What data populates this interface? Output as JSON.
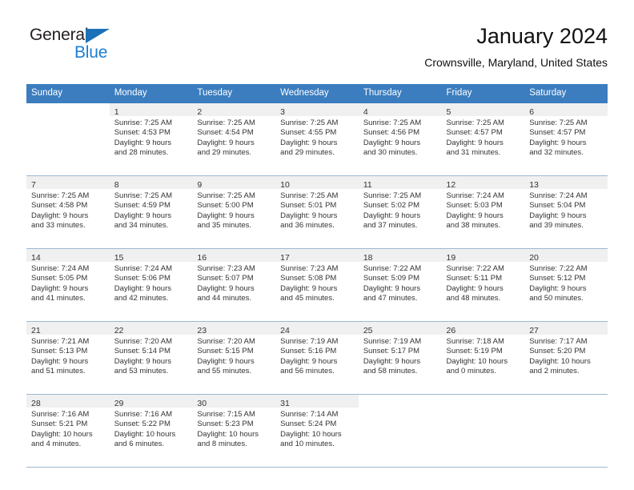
{
  "brand": {
    "name_part1": "General",
    "name_part2": "Blue",
    "accent_color": "#1c7fd1",
    "triangle_color": "#1c71b8"
  },
  "header": {
    "title": "January 2024",
    "subtitle": "Crownsville, Maryland, United States",
    "header_bg_color": "#3b7dbf",
    "header_text_color": "#ffffff"
  },
  "weekdays": [
    "Sunday",
    "Monday",
    "Tuesday",
    "Wednesday",
    "Thursday",
    "Friday",
    "Saturday"
  ],
  "weeks": [
    [
      {
        "day": "",
        "sunrise": "",
        "sunset": "",
        "daylight1": "",
        "daylight2": ""
      },
      {
        "day": "1",
        "sunrise": "Sunrise: 7:25 AM",
        "sunset": "Sunset: 4:53 PM",
        "daylight1": "Daylight: 9 hours",
        "daylight2": "and 28 minutes."
      },
      {
        "day": "2",
        "sunrise": "Sunrise: 7:25 AM",
        "sunset": "Sunset: 4:54 PM",
        "daylight1": "Daylight: 9 hours",
        "daylight2": "and 29 minutes."
      },
      {
        "day": "3",
        "sunrise": "Sunrise: 7:25 AM",
        "sunset": "Sunset: 4:55 PM",
        "daylight1": "Daylight: 9 hours",
        "daylight2": "and 29 minutes."
      },
      {
        "day": "4",
        "sunrise": "Sunrise: 7:25 AM",
        "sunset": "Sunset: 4:56 PM",
        "daylight1": "Daylight: 9 hours",
        "daylight2": "and 30 minutes."
      },
      {
        "day": "5",
        "sunrise": "Sunrise: 7:25 AM",
        "sunset": "Sunset: 4:57 PM",
        "daylight1": "Daylight: 9 hours",
        "daylight2": "and 31 minutes."
      },
      {
        "day": "6",
        "sunrise": "Sunrise: 7:25 AM",
        "sunset": "Sunset: 4:57 PM",
        "daylight1": "Daylight: 9 hours",
        "daylight2": "and 32 minutes."
      }
    ],
    [
      {
        "day": "7",
        "sunrise": "Sunrise: 7:25 AM",
        "sunset": "Sunset: 4:58 PM",
        "daylight1": "Daylight: 9 hours",
        "daylight2": "and 33 minutes."
      },
      {
        "day": "8",
        "sunrise": "Sunrise: 7:25 AM",
        "sunset": "Sunset: 4:59 PM",
        "daylight1": "Daylight: 9 hours",
        "daylight2": "and 34 minutes."
      },
      {
        "day": "9",
        "sunrise": "Sunrise: 7:25 AM",
        "sunset": "Sunset: 5:00 PM",
        "daylight1": "Daylight: 9 hours",
        "daylight2": "and 35 minutes."
      },
      {
        "day": "10",
        "sunrise": "Sunrise: 7:25 AM",
        "sunset": "Sunset: 5:01 PM",
        "daylight1": "Daylight: 9 hours",
        "daylight2": "and 36 minutes."
      },
      {
        "day": "11",
        "sunrise": "Sunrise: 7:25 AM",
        "sunset": "Sunset: 5:02 PM",
        "daylight1": "Daylight: 9 hours",
        "daylight2": "and 37 minutes."
      },
      {
        "day": "12",
        "sunrise": "Sunrise: 7:24 AM",
        "sunset": "Sunset: 5:03 PM",
        "daylight1": "Daylight: 9 hours",
        "daylight2": "and 38 minutes."
      },
      {
        "day": "13",
        "sunrise": "Sunrise: 7:24 AM",
        "sunset": "Sunset: 5:04 PM",
        "daylight1": "Daylight: 9 hours",
        "daylight2": "and 39 minutes."
      }
    ],
    [
      {
        "day": "14",
        "sunrise": "Sunrise: 7:24 AM",
        "sunset": "Sunset: 5:05 PM",
        "daylight1": "Daylight: 9 hours",
        "daylight2": "and 41 minutes."
      },
      {
        "day": "15",
        "sunrise": "Sunrise: 7:24 AM",
        "sunset": "Sunset: 5:06 PM",
        "daylight1": "Daylight: 9 hours",
        "daylight2": "and 42 minutes."
      },
      {
        "day": "16",
        "sunrise": "Sunrise: 7:23 AM",
        "sunset": "Sunset: 5:07 PM",
        "daylight1": "Daylight: 9 hours",
        "daylight2": "and 44 minutes."
      },
      {
        "day": "17",
        "sunrise": "Sunrise: 7:23 AM",
        "sunset": "Sunset: 5:08 PM",
        "daylight1": "Daylight: 9 hours",
        "daylight2": "and 45 minutes."
      },
      {
        "day": "18",
        "sunrise": "Sunrise: 7:22 AM",
        "sunset": "Sunset: 5:09 PM",
        "daylight1": "Daylight: 9 hours",
        "daylight2": "and 47 minutes."
      },
      {
        "day": "19",
        "sunrise": "Sunrise: 7:22 AM",
        "sunset": "Sunset: 5:11 PM",
        "daylight1": "Daylight: 9 hours",
        "daylight2": "and 48 minutes."
      },
      {
        "day": "20",
        "sunrise": "Sunrise: 7:22 AM",
        "sunset": "Sunset: 5:12 PM",
        "daylight1": "Daylight: 9 hours",
        "daylight2": "and 50 minutes."
      }
    ],
    [
      {
        "day": "21",
        "sunrise": "Sunrise: 7:21 AM",
        "sunset": "Sunset: 5:13 PM",
        "daylight1": "Daylight: 9 hours",
        "daylight2": "and 51 minutes."
      },
      {
        "day": "22",
        "sunrise": "Sunrise: 7:20 AM",
        "sunset": "Sunset: 5:14 PM",
        "daylight1": "Daylight: 9 hours",
        "daylight2": "and 53 minutes."
      },
      {
        "day": "23",
        "sunrise": "Sunrise: 7:20 AM",
        "sunset": "Sunset: 5:15 PM",
        "daylight1": "Daylight: 9 hours",
        "daylight2": "and 55 minutes."
      },
      {
        "day": "24",
        "sunrise": "Sunrise: 7:19 AM",
        "sunset": "Sunset: 5:16 PM",
        "daylight1": "Daylight: 9 hours",
        "daylight2": "and 56 minutes."
      },
      {
        "day": "25",
        "sunrise": "Sunrise: 7:19 AM",
        "sunset": "Sunset: 5:17 PM",
        "daylight1": "Daylight: 9 hours",
        "daylight2": "and 58 minutes."
      },
      {
        "day": "26",
        "sunrise": "Sunrise: 7:18 AM",
        "sunset": "Sunset: 5:19 PM",
        "daylight1": "Daylight: 10 hours",
        "daylight2": "and 0 minutes."
      },
      {
        "day": "27",
        "sunrise": "Sunrise: 7:17 AM",
        "sunset": "Sunset: 5:20 PM",
        "daylight1": "Daylight: 10 hours",
        "daylight2": "and 2 minutes."
      }
    ],
    [
      {
        "day": "28",
        "sunrise": "Sunrise: 7:16 AM",
        "sunset": "Sunset: 5:21 PM",
        "daylight1": "Daylight: 10 hours",
        "daylight2": "and 4 minutes."
      },
      {
        "day": "29",
        "sunrise": "Sunrise: 7:16 AM",
        "sunset": "Sunset: 5:22 PM",
        "daylight1": "Daylight: 10 hours",
        "daylight2": "and 6 minutes."
      },
      {
        "day": "30",
        "sunrise": "Sunrise: 7:15 AM",
        "sunset": "Sunset: 5:23 PM",
        "daylight1": "Daylight: 10 hours",
        "daylight2": "and 8 minutes."
      },
      {
        "day": "31",
        "sunrise": "Sunrise: 7:14 AM",
        "sunset": "Sunset: 5:24 PM",
        "daylight1": "Daylight: 10 hours",
        "daylight2": "and 10 minutes."
      },
      {
        "day": "",
        "sunrise": "",
        "sunset": "",
        "daylight1": "",
        "daylight2": ""
      },
      {
        "day": "",
        "sunrise": "",
        "sunset": "",
        "daylight1": "",
        "daylight2": ""
      },
      {
        "day": "",
        "sunrise": "",
        "sunset": "",
        "daylight1": "",
        "daylight2": ""
      }
    ]
  ]
}
